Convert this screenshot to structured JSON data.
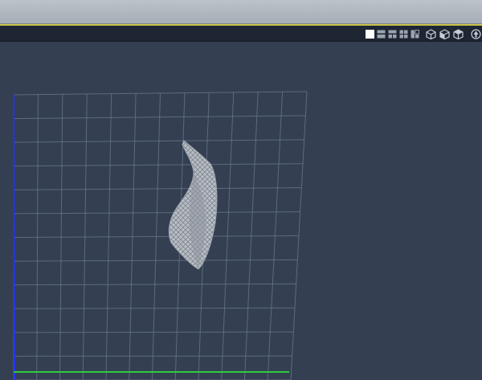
{
  "app": {
    "title": ""
  },
  "toolbar": {
    "layout_buttons": [
      {
        "icon": "single-view-icon",
        "active": true
      },
      {
        "icon": "two-view-horizontal-icon",
        "active": false
      },
      {
        "icon": "two-view-vertical-icon",
        "active": false
      },
      {
        "icon": "four-view-icon",
        "active": false
      },
      {
        "icon": "three-view-icon",
        "active": false
      }
    ],
    "view_buttons": [
      {
        "icon": "perspective-cube-icon"
      },
      {
        "icon": "front-cube-icon"
      },
      {
        "icon": "top-cube-icon"
      }
    ],
    "extra_buttons": [
      {
        "icon": "up-arrow-circle-icon"
      }
    ]
  },
  "viewport": {
    "background": "#343f52",
    "grid_color": "#6e7d92",
    "axis_x_color": "#2ecc40",
    "axis_y_color": "#2233ee",
    "model_color": "#b8bdc4"
  }
}
